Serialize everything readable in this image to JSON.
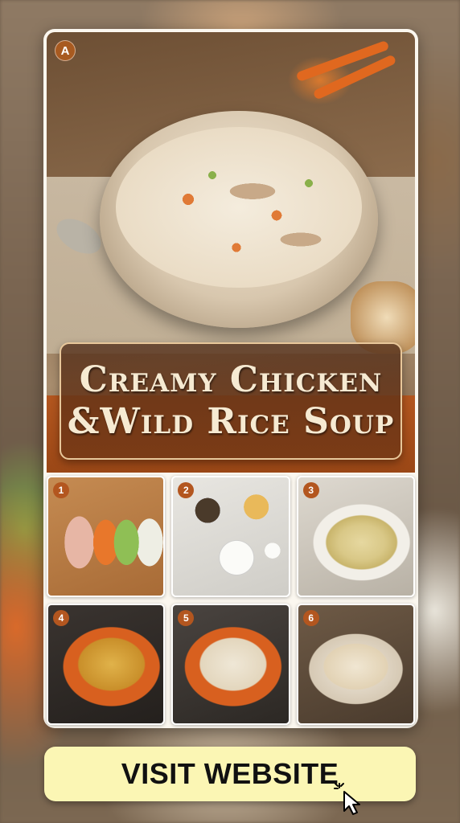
{
  "hero": {
    "badge": "A",
    "title_line1": "Creamy Chicken",
    "title_line2": "&Wild Rice Soup"
  },
  "steps": [
    {
      "number": "1"
    },
    {
      "number": "2"
    },
    {
      "number": "3"
    },
    {
      "number": "4"
    },
    {
      "number": "5"
    },
    {
      "number": "6"
    }
  ],
  "cta": {
    "label": "VISIT WEBSITE",
    "cursor_icon": "pointer-cursor-icon"
  },
  "colors": {
    "accent": "#b3561f",
    "cta_background": "#fbf6b4",
    "title_text": "#f6ead2"
  }
}
